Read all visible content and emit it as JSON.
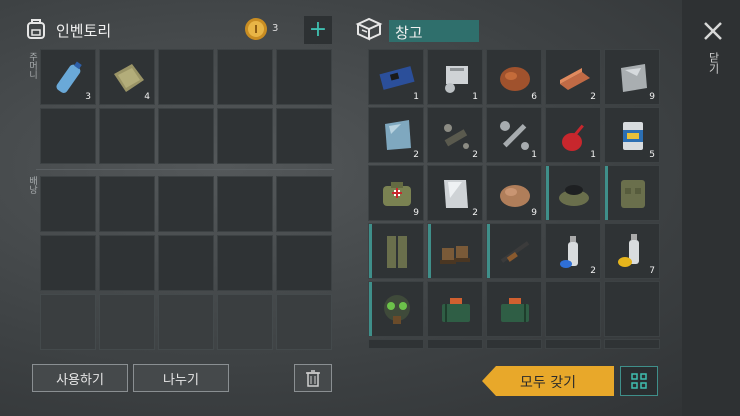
{
  "inventory": {
    "title": "인벤토리",
    "coin_count": "3",
    "pocket_label": "주머니",
    "backpack_label": "배낭",
    "pocket_items": [
      {
        "name": "water-bottle",
        "qty": "3"
      },
      {
        "name": "cloth",
        "qty": "4"
      }
    ],
    "use_button": "사용하기",
    "split_button": "나누기"
  },
  "storage": {
    "title": "창고",
    "items": [
      {
        "name": "circuit-board",
        "qty": "1"
      },
      {
        "name": "engine-part",
        "qty": "1"
      },
      {
        "name": "copper-ore",
        "qty": "6"
      },
      {
        "name": "copper-ingot",
        "qty": "2"
      },
      {
        "name": "metal-plate",
        "qty": "9"
      },
      {
        "name": "glass-pane",
        "qty": "2"
      },
      {
        "name": "scope-parts",
        "qty": "2"
      },
      {
        "name": "wrench",
        "qty": "1"
      },
      {
        "name": "oil-can",
        "qty": "1"
      },
      {
        "name": "food-can",
        "qty": "5"
      },
      {
        "name": "medical-bag",
        "qty": "9"
      },
      {
        "name": "steel-sheet",
        "qty": "2"
      },
      {
        "name": "stone",
        "qty": "9"
      },
      {
        "name": "military-cap",
        "qty": ""
      },
      {
        "name": "military-vest",
        "qty": ""
      },
      {
        "name": "military-pants",
        "qty": ""
      },
      {
        "name": "military-boots",
        "qty": ""
      },
      {
        "name": "assault-rifle",
        "qty": ""
      },
      {
        "name": "spray-can-blue",
        "qty": "2"
      },
      {
        "name": "spray-can-yellow",
        "qty": "7"
      },
      {
        "name": "gas-mask",
        "qty": ""
      },
      {
        "name": "explosive-box-1",
        "qty": ""
      },
      {
        "name": "explosive-box-2",
        "qty": ""
      }
    ],
    "take_all_button": "모두 갖기"
  },
  "close_label": "닫기",
  "colors": {
    "accent": "#3f8f8a",
    "take_all": "#e8a82a",
    "storage_title_bg": "#2f6f6c"
  }
}
